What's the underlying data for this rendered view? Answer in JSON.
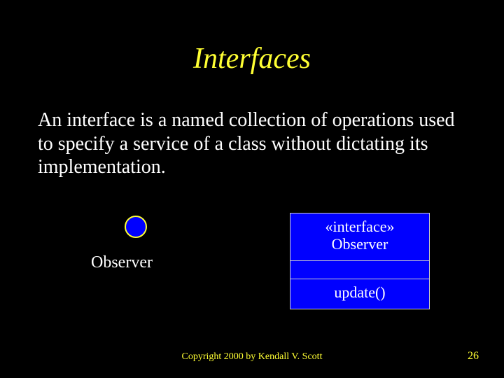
{
  "title": "Interfaces",
  "body": "An interface is a named collection of operations used to specify a service of a class without dictating its implementation.",
  "lollipop_label": "Observer",
  "uml": {
    "stereotype": "«interface»",
    "name": "Observer",
    "operation": "update()"
  },
  "footer": "Copyright 2000 by Kendall V. Scott",
  "page_number": "26"
}
